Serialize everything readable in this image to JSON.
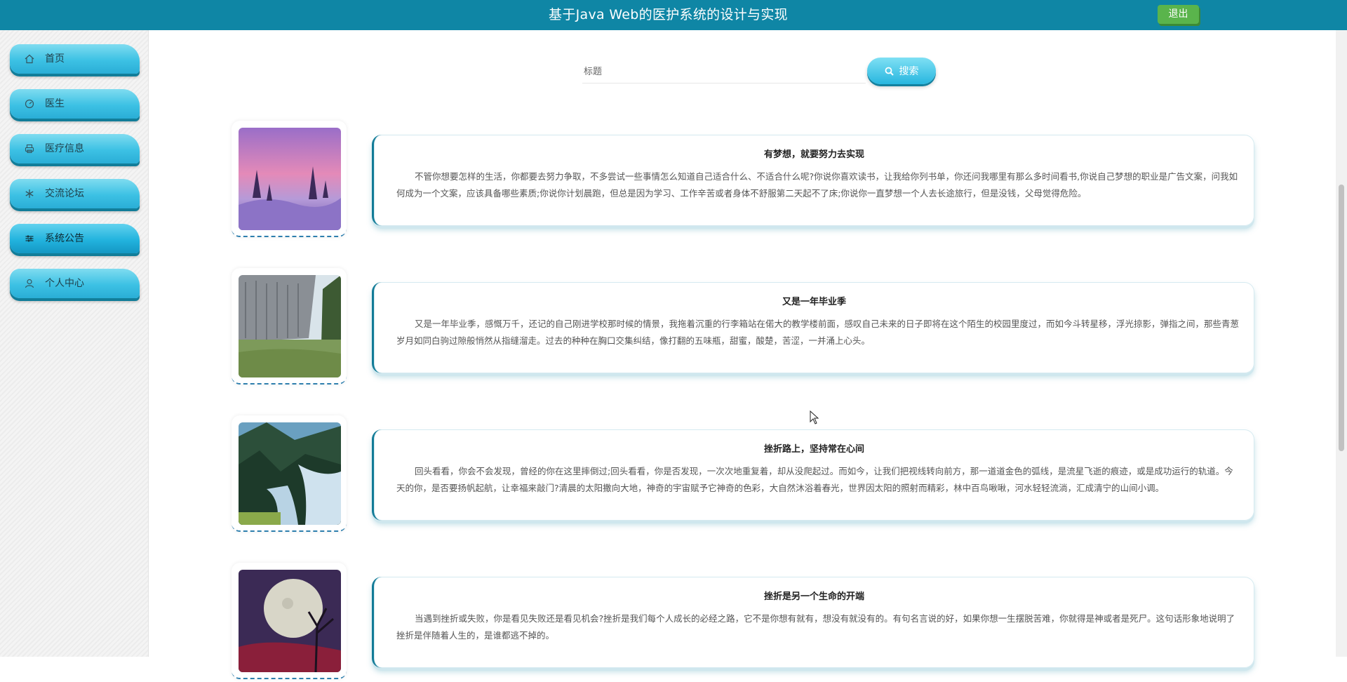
{
  "header": {
    "title": "基于Java Web的医护系统的设计与实现",
    "logout_label": "退出"
  },
  "sidebar": {
    "items": [
      {
        "label": "首页",
        "icon": "home-icon"
      },
      {
        "label": "医生",
        "icon": "dashboard-icon"
      },
      {
        "label": "医疗信息",
        "icon": "print-icon"
      },
      {
        "label": "交流论坛",
        "icon": "snowflake-icon"
      },
      {
        "label": "系统公告",
        "icon": "sliders-icon",
        "active": true
      },
      {
        "label": "个人中心",
        "icon": "user-icon"
      }
    ]
  },
  "search": {
    "placeholder": "标题",
    "button_label": "搜索"
  },
  "notices": [
    {
      "title": "有梦想，就要努力去实现",
      "content": "不管你想要怎样的生活，你都要去努力争取，不多尝试一些事情怎么知道自己适合什么、不适合什么呢?你说你喜欢读书，让我给你列书单，你还问我哪里有那么多时间看书,你说自己梦想的职业是广告文案，问我如何成为一个文案，应该具备哪些素质;你说你计划晨跑，但总是因为学习、工作辛苦或者身体不舒服第二天起不了床;你说你一直梦想一个人去长途旅行，但是没钱，父母觉得危险。",
      "image": "pink-snow-forest"
    },
    {
      "title": "又是一年毕业季",
      "content": "又是一年毕业季，感慨万千，还记的自己刚进学校那时候的情景，我拖着沉重的行李箱站在偌大的教学楼前面，感叹自己未来的日子即将在这个陌生的校园里度过，而如今斗转星移，浮光掠影，弹指之间，那些青葱岁月如同白驹过隙般悄然从指缝溜走。过去的种种在胸口交集纠结，像打翻的五味瓶，甜蜜，酸楚，苦涩，一并涌上心头。",
      "image": "canyon-river"
    },
    {
      "title": "挫折路上，坚持常在心间",
      "content": "回头看看，你会不会发现，曾经的你在这里摔倒过;回头看看，你是否发现，一次次地重复着，却从没爬起过。而如今，让我们把视线转向前方，那一道道金色的弧线，是流星飞逝的痕迹，或是成功运行的轨道。今天的你，是否要扬帆起航，让幸福来敲门?清晨的太阳撒向大地，神奇的宇宙赋予它神奇的色彩，大自然沐浴着春光，世界因太阳的照射而精彩，林中百鸟啾啾，河水轻轻流淌，汇成清宁的山间小调。",
      "image": "mountain-waterfall"
    },
    {
      "title": "挫折是另一个生命的开端",
      "content": "当遇到挫折或失败，你是看见失败还是看见机会?挫折是我们每个人成长的必经之路，它不是你想有就有，想没有就没有的。有句名言说的好，如果你想一生摆脱苦难，你就得是神或者是死尸。这句话形象地说明了挫折是伴随着人生的，是谁都逃不掉的。",
      "image": "moon-tree-night"
    }
  ]
}
